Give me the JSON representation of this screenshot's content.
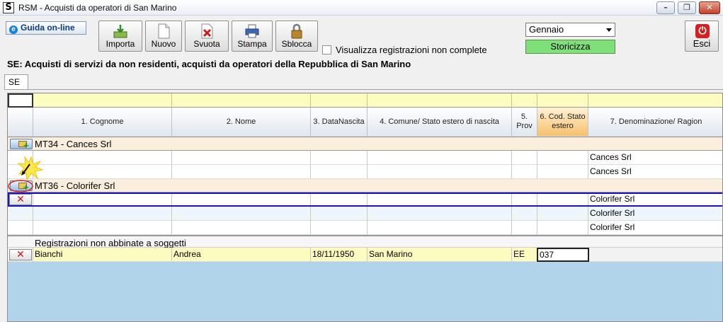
{
  "window": {
    "title": "RSM - Acquisti da operatori di San Marino",
    "app_icon": "S",
    "minimize": "–",
    "maximize": "❐",
    "close": "✕"
  },
  "toolbar": {
    "guida_label": "Guida on-line",
    "guida_icon": "e",
    "buttons": [
      {
        "label": "Importa",
        "icon": "import-icon"
      },
      {
        "label": "Nuovo",
        "icon": "new-document-icon"
      },
      {
        "label": "Svuota",
        "icon": "clear-icon"
      },
      {
        "label": "Stampa",
        "icon": "printer-icon"
      },
      {
        "label": "Sblocca",
        "icon": "lock-icon"
      }
    ],
    "checkbox_label": "Visualizza registrazioni non complete",
    "checkbox_checked": false,
    "month_selected": "Gennaio",
    "storicizza_label": "Storicizza",
    "storicizza_color": "#7fe07a",
    "esci_label": "Esci",
    "esci_icon": "power-icon"
  },
  "section_title": "SE: Acquisti di servizi da non residenti, acquisti da operatori della Repubblica di San Marino",
  "tab_label": "SE",
  "columns": [
    "1. Cognome",
    "2. Nome",
    "3. DataNascita",
    "4. Comune/ Stato estero di nascita",
    "5. Prov",
    "6. Cod. Stato estero",
    "7. Denominazione/ Ragion"
  ],
  "groups": [
    {
      "title": "MT34 - Cances Srl",
      "rows": [
        "Cances Srl",
        "Cances Srl"
      ]
    },
    {
      "title": "MT36 - Colorifer Srl",
      "rows": [
        "Colorifer Srl",
        "Colorifer Srl",
        "Colorifer Srl"
      ]
    }
  ],
  "uncoupled": {
    "title": "Registrazioni non abbinate a soggetti",
    "row": {
      "cognome": "Bianchi",
      "nome": "Andrea",
      "data_nascita": "18/11/1950",
      "comune": "San Marino",
      "prov": "EE",
      "cod_stato": "037"
    }
  },
  "colors": {
    "header_highlight": "#f6c16c",
    "filter_row": "#fdfcc0",
    "group_row": "#fbeedd",
    "grid_background": "#b2d4ea",
    "selection": "#1a14c8"
  }
}
